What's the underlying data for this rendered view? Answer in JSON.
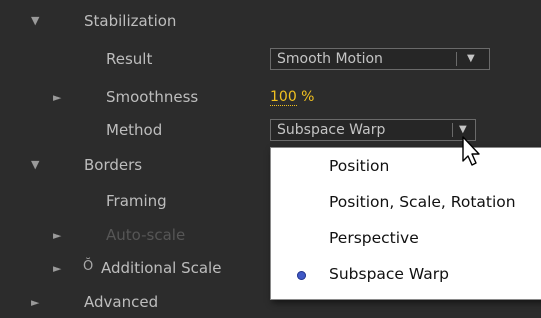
{
  "stabilization": {
    "twirl": "▼",
    "label": "Stabilization",
    "result": {
      "label": "Result",
      "value": "Smooth Motion"
    },
    "smoothness": {
      "twirl": "►",
      "label": "Smoothness",
      "value": "100",
      "unit": " %"
    },
    "method": {
      "label": "Method",
      "value": "Subspace Warp"
    }
  },
  "borders": {
    "twirl": "▼",
    "label": "Borders",
    "framing": {
      "label": "Framing"
    },
    "auto_scale": {
      "twirl": "►",
      "label": "Auto-scale"
    },
    "additional_scale": {
      "twirl": "►",
      "stopwatch": "Ŏ",
      "label": "Additional Scale"
    }
  },
  "advanced": {
    "twirl": "►",
    "label": "Advanced"
  },
  "method_menu": {
    "selected": "Subspace Warp",
    "items": [
      {
        "label": "Position"
      },
      {
        "label": "Position, Scale, Rotation"
      },
      {
        "label": "Perspective"
      },
      {
        "label": "Subspace Warp"
      }
    ]
  },
  "colors": {
    "panel_bg": "#2c2c2c",
    "value_link": "#f0c020",
    "radio_selected": "#3f58c6",
    "menu_bg": "#ffffff"
  },
  "icons": {
    "twirl_open": "triangle-down-icon",
    "twirl_closed": "triangle-right-icon",
    "dropdown": "dropdown-arrow-icon",
    "stopwatch": "stopwatch-icon",
    "cursor": "mouse-pointer-icon",
    "selected": "radio-dot-icon"
  }
}
